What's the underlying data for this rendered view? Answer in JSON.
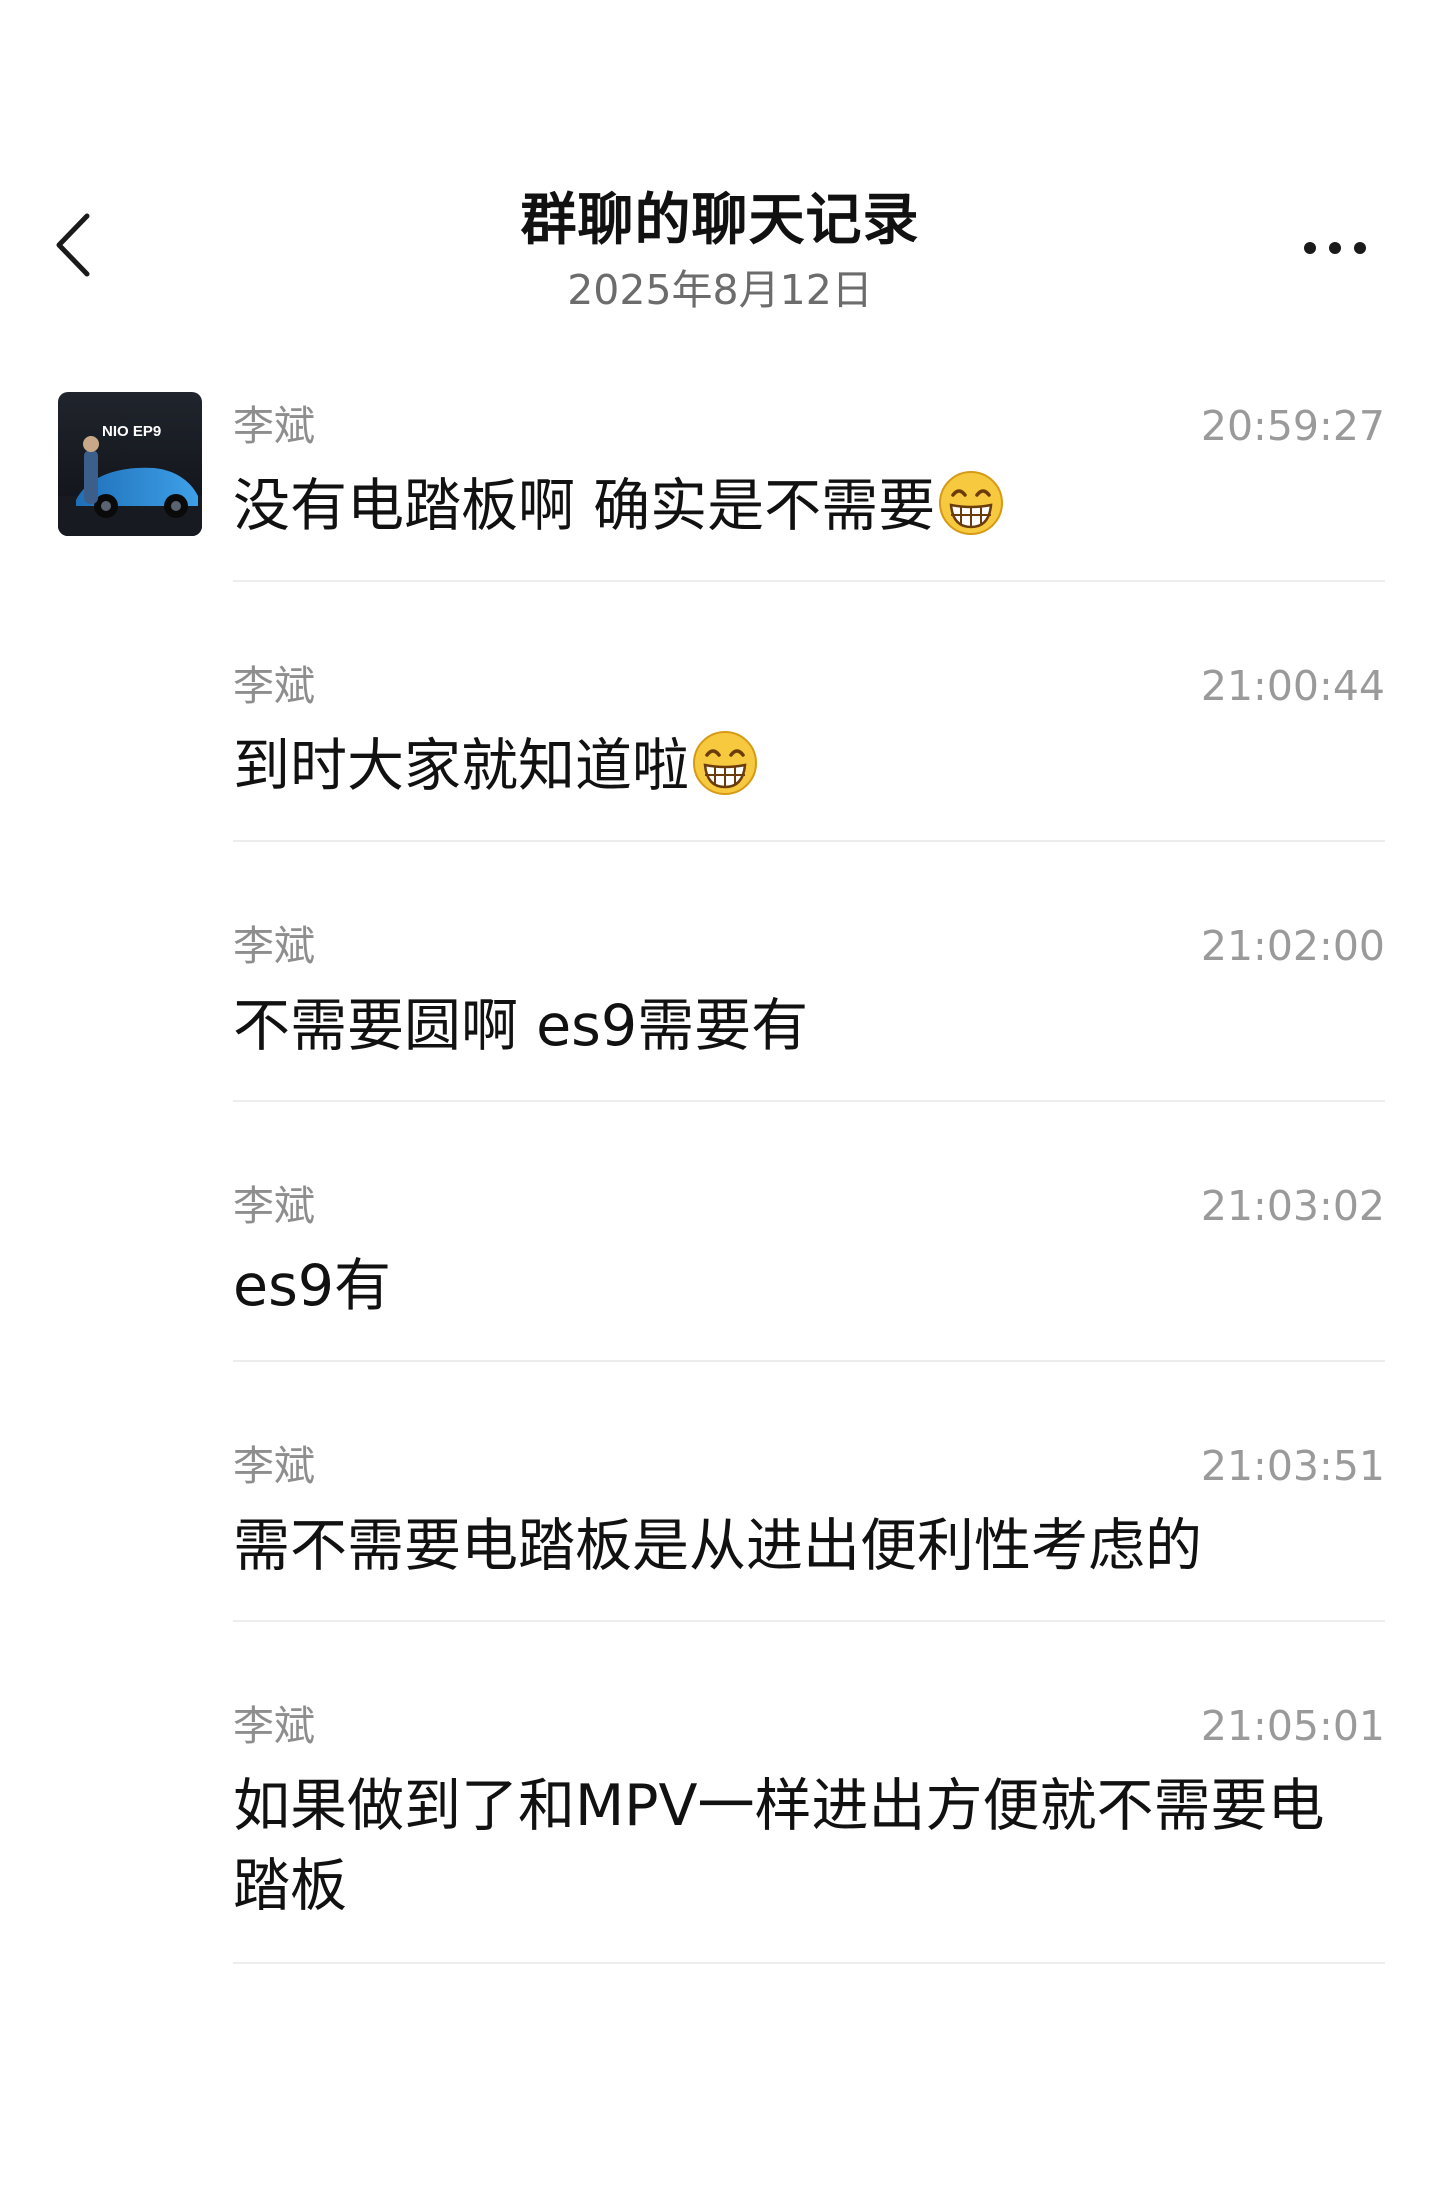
{
  "header": {
    "back_icon": "chevron-left-icon",
    "title": "群聊的聊天记录",
    "date": "2025年8月12日",
    "more_icon": "ellipsis-icon"
  },
  "avatar": {
    "brand_text": "NIO EP9"
  },
  "emoji": "grinning-face-icon",
  "messages": [
    {
      "sender": "李斌",
      "time": "20:59:27",
      "text": "没有电踏板啊 确实是不需要",
      "emoji": true
    },
    {
      "sender": "李斌",
      "time": "21:00:44",
      "text": "到时大家就知道啦",
      "emoji": true
    },
    {
      "sender": "李斌",
      "time": "21:02:00",
      "text": "不需要圆啊 es9需要有",
      "emoji": false
    },
    {
      "sender": "李斌",
      "time": "21:03:02",
      "text": "es9有",
      "emoji": false
    },
    {
      "sender": "李斌",
      "time": "21:03:51",
      "text": "需不需要电踏板是从进出便利性考虑的",
      "emoji": false
    },
    {
      "sender": "李斌",
      "time": "21:05:01",
      "text": "如果做到了和MPV一样进出方便就不需要电踏板",
      "emoji": false
    }
  ]
}
